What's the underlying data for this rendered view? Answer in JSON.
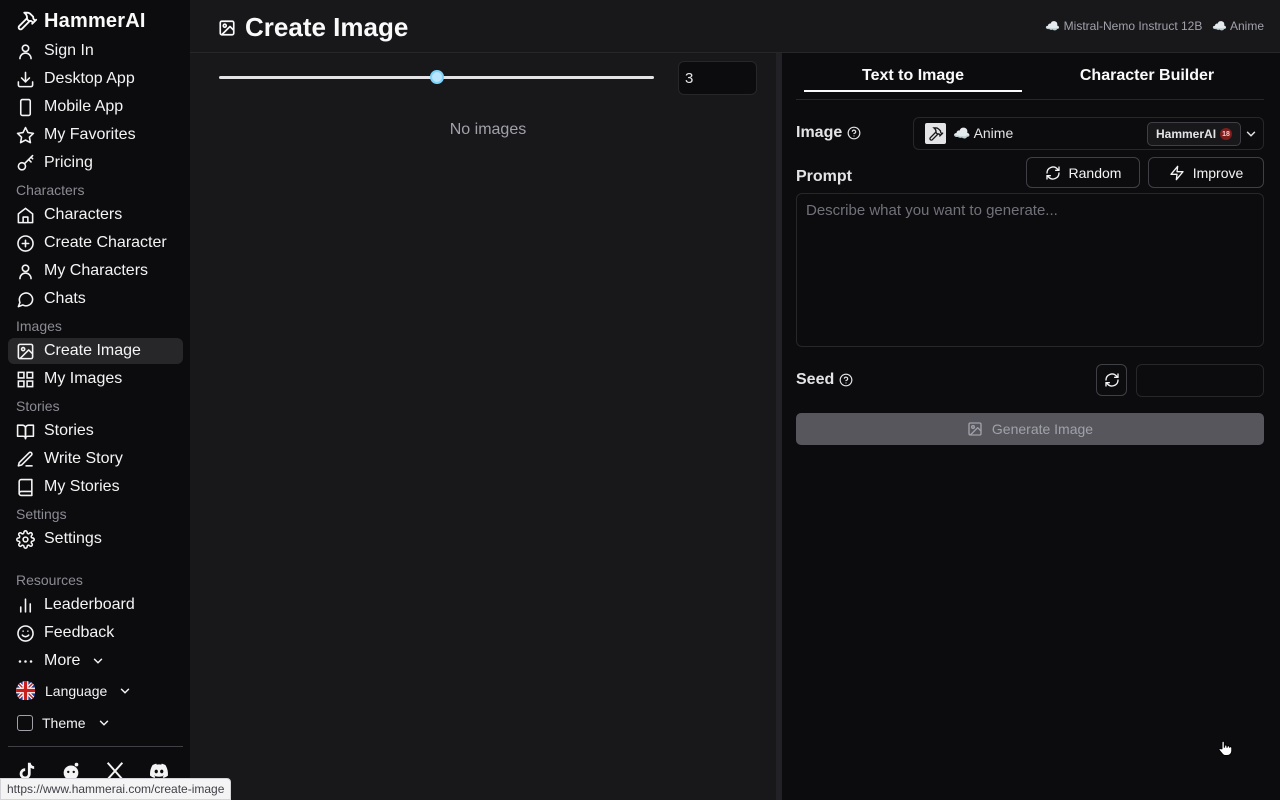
{
  "brand": {
    "name": "HammerAI"
  },
  "sidebar": {
    "top_items": [
      {
        "label": "Sign In",
        "icon": "user-icon"
      },
      {
        "label": "Desktop App",
        "icon": "download-icon"
      },
      {
        "label": "Mobile App",
        "icon": "smartphone-icon"
      },
      {
        "label": "My Favorites",
        "icon": "star-icon"
      },
      {
        "label": "Pricing",
        "icon": "key-icon"
      }
    ],
    "sections": {
      "characters": "Characters",
      "images": "Images",
      "stories": "Stories",
      "settings": "Settings",
      "resources": "Resources"
    },
    "character_items": [
      {
        "label": "Characters",
        "icon": "home-icon"
      },
      {
        "label": "Create Character",
        "icon": "plus-circle-icon"
      },
      {
        "label": "My Characters",
        "icon": "user-icon"
      },
      {
        "label": "Chats",
        "icon": "message-circle-icon"
      }
    ],
    "image_items": [
      {
        "label": "Create Image",
        "icon": "image-icon",
        "active": true
      },
      {
        "label": "My Images",
        "icon": "grid-icon"
      }
    ],
    "story_items": [
      {
        "label": "Stories",
        "icon": "book-open-icon"
      },
      {
        "label": "Write Story",
        "icon": "pen-icon"
      },
      {
        "label": "My Stories",
        "icon": "book-icon"
      }
    ],
    "settings_items": [
      {
        "label": "Settings",
        "icon": "gear-icon"
      }
    ],
    "resource_items": [
      {
        "label": "Leaderboard",
        "icon": "bar-chart-icon"
      },
      {
        "label": "Feedback",
        "icon": "smile-icon"
      },
      {
        "label": "More",
        "icon": "ellipsis-icon"
      },
      {
        "label": "Language",
        "icon": "uk-flag-icon"
      },
      {
        "label": "Theme",
        "icon": "checkbox-icon"
      }
    ],
    "socials": [
      "tiktok-icon",
      "reddit-icon",
      "x-icon",
      "discord-icon"
    ]
  },
  "header": {
    "title": "Create Image",
    "chat_model": "Mistral-Nemo Instruct 12B",
    "image_model": "Anime",
    "cloud_glyph": "☁️"
  },
  "gallery": {
    "count_value": "3",
    "slider_fraction": 0.5,
    "empty_text": "No images"
  },
  "panel": {
    "tabs": [
      "Text to Image",
      "Character Builder"
    ],
    "active_tab": 0,
    "image_label": "Image",
    "model_name": "Anime",
    "model_badge": "HammerAI",
    "model_badge_rating": "18",
    "prompt_label": "Prompt",
    "random_label": "Random",
    "improve_label": "Improve",
    "prompt_placeholder": "Describe what you want to generate...",
    "prompt_value": "",
    "seed_label": "Seed",
    "seed_value": "",
    "generate_label": "Generate Image"
  },
  "status_url": "https://www.hammerai.com/create-image",
  "colors": {
    "sidebar_bg": "#0c0c0e",
    "main_bg": "#18181b",
    "panel_bg": "#0c0c0e",
    "accent_slider": "#7dd3fc",
    "disabled_button": "#56565c"
  }
}
